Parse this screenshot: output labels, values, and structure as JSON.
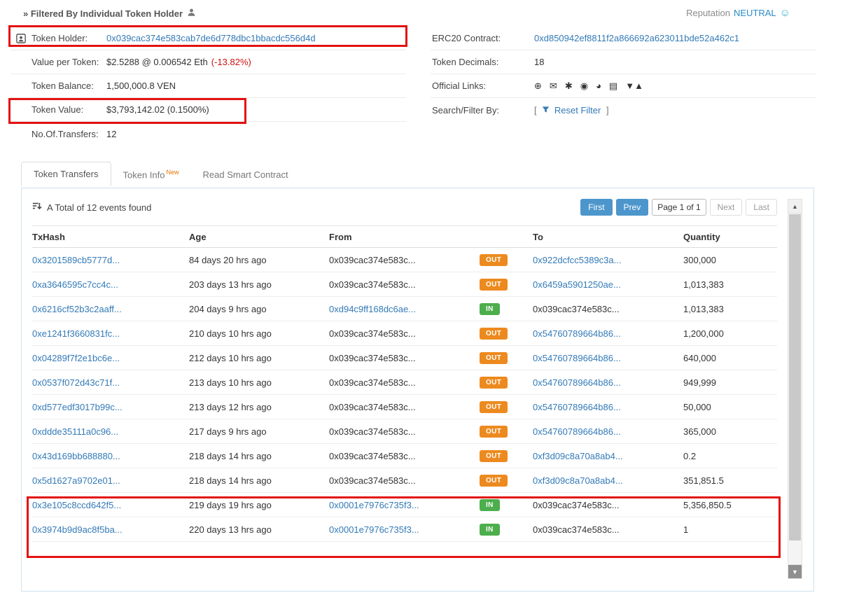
{
  "breadcrumb": {
    "text": "» Filtered By Individual Token Holder"
  },
  "reputation": {
    "label": "Reputation",
    "value": "NEUTRAL",
    "smiley": "☺"
  },
  "summary_left": {
    "token_holder_label": "Token Holder:",
    "token_holder_value": "0x039cac374e583cab7de6d778dbc1bbacdc556d4d",
    "value_per_token_label": "Value per Token:",
    "value_per_token_value": "$2.5288 @ 0.006542 Eth",
    "value_per_token_change": "(-13.82%)",
    "token_balance_label": "Token Balance:",
    "token_balance_value": "1,500,000.8 VEN",
    "token_value_label": "Token Value:",
    "token_value_value": "$3,793,142.02 (0.1500%)",
    "transfers_label": "No.Of.Transfers:",
    "transfers_value": "12"
  },
  "summary_right": {
    "contract_label": "ERC20 Contract:",
    "contract_value": "0xd850942ef8811f2a866692a623011bde52a462c1",
    "decimals_label": "Token Decimals:",
    "decimals_value": "18",
    "links_label": "Official Links:",
    "links_icons": [
      {
        "name": "website-globe-icon",
        "glyph": "⊕"
      },
      {
        "name": "email-icon",
        "glyph": "✉"
      },
      {
        "name": "support-asterisk-icon",
        "glyph": "✱"
      },
      {
        "name": "github-icon",
        "glyph": "◉"
      },
      {
        "name": "coingecko-icon",
        "glyph": "◕"
      },
      {
        "name": "whitepaper-document-icon",
        "glyph": "▤"
      },
      {
        "name": "forum-triangles-icon",
        "glyph": "▼▲"
      }
    ],
    "filter_label": "Search/Filter By:",
    "filter_open": "[",
    "filter_reset": "Reset Filter",
    "filter_close": "]"
  },
  "tabs": [
    {
      "label": "Token Transfers"
    },
    {
      "label": "Token Info",
      "badge": "New"
    },
    {
      "label": "Read Smart Contract"
    }
  ],
  "events": {
    "summary": "A Total of 12 events found"
  },
  "pagination": {
    "first": "First",
    "prev": "Prev",
    "page_indicator": "Page 1 of 1",
    "next": "Next",
    "last": "Last"
  },
  "table": {
    "headers": {
      "txhash": "TxHash",
      "age": "Age",
      "from": "From",
      "to": "To",
      "quantity": "Quantity"
    },
    "rows": [
      {
        "txhash": "0x3201589cb5777d...",
        "age": "84 days 20 hrs ago",
        "from": "0x039cac374e583c...",
        "direction": "OUT",
        "to": "0x922dcfcc5389c3a...",
        "quantity": "300,000"
      },
      {
        "txhash": "0xa3646595c7cc4c...",
        "age": "203 days 13 hrs ago",
        "from": "0x039cac374e583c...",
        "direction": "OUT",
        "to": "0x6459a5901250ae...",
        "quantity": "1,013,383"
      },
      {
        "txhash": "0x6216cf52b3c2aaff...",
        "age": "204 days 9 hrs ago",
        "from": "0xd94c9ff168dc6ae...",
        "direction": "IN",
        "to": "0x039cac374e583c...",
        "quantity": "1,013,383"
      },
      {
        "txhash": "0xe1241f3660831fc...",
        "age": "210 days 10 hrs ago",
        "from": "0x039cac374e583c...",
        "direction": "OUT",
        "to": "0x54760789664b86...",
        "quantity": "1,200,000"
      },
      {
        "txhash": "0x04289f7f2e1bc6e...",
        "age": "212 days 10 hrs ago",
        "from": "0x039cac374e583c...",
        "direction": "OUT",
        "to": "0x54760789664b86...",
        "quantity": "640,000"
      },
      {
        "txhash": "0x0537f072d43c71f...",
        "age": "213 days 10 hrs ago",
        "from": "0x039cac374e583c...",
        "direction": "OUT",
        "to": "0x54760789664b86...",
        "quantity": "949,999"
      },
      {
        "txhash": "0xd577edf3017b99c...",
        "age": "213 days 12 hrs ago",
        "from": "0x039cac374e583c...",
        "direction": "OUT",
        "to": "0x54760789664b86...",
        "quantity": "50,000"
      },
      {
        "txhash": "0xddde35111a0c96...",
        "age": "217 days 9 hrs ago",
        "from": "0x039cac374e583c...",
        "direction": "OUT",
        "to": "0x54760789664b86...",
        "quantity": "365,000"
      },
      {
        "txhash": "0x43d169bb688880...",
        "age": "218 days 14 hrs ago",
        "from": "0x039cac374e583c...",
        "direction": "OUT",
        "to": "0xf3d09c8a70a8ab4...",
        "quantity": "0.2"
      },
      {
        "txhash": "0x5d1627a9702e01...",
        "age": "218 days 14 hrs ago",
        "from": "0x039cac374e583c...",
        "direction": "OUT",
        "to": "0xf3d09c8a70a8ab4...",
        "quantity": "351,851.5"
      },
      {
        "txhash": "0x3e105c8ccd642f5...",
        "age": "219 days 19 hrs ago",
        "from": "0x0001e7976c735f3...",
        "direction": "IN",
        "to": "0x039cac374e583c...",
        "quantity": "5,356,850.5"
      },
      {
        "txhash": "0x3974b9d9ac8f5ba...",
        "age": "220 days 13 hrs ago",
        "from": "0x0001e7976c735f3...",
        "direction": "IN",
        "to": "0x039cac374e583c...",
        "quantity": "1"
      }
    ]
  },
  "scrollbar": {
    "up_glyph": "▲",
    "down_glyph": "▼"
  },
  "colors": {
    "link": "#337ab7",
    "out_badge": "#ed8a1f",
    "in_badge": "#4cae4c",
    "reputation_value": "#2a8cc7",
    "annotation": "#e31212"
  }
}
